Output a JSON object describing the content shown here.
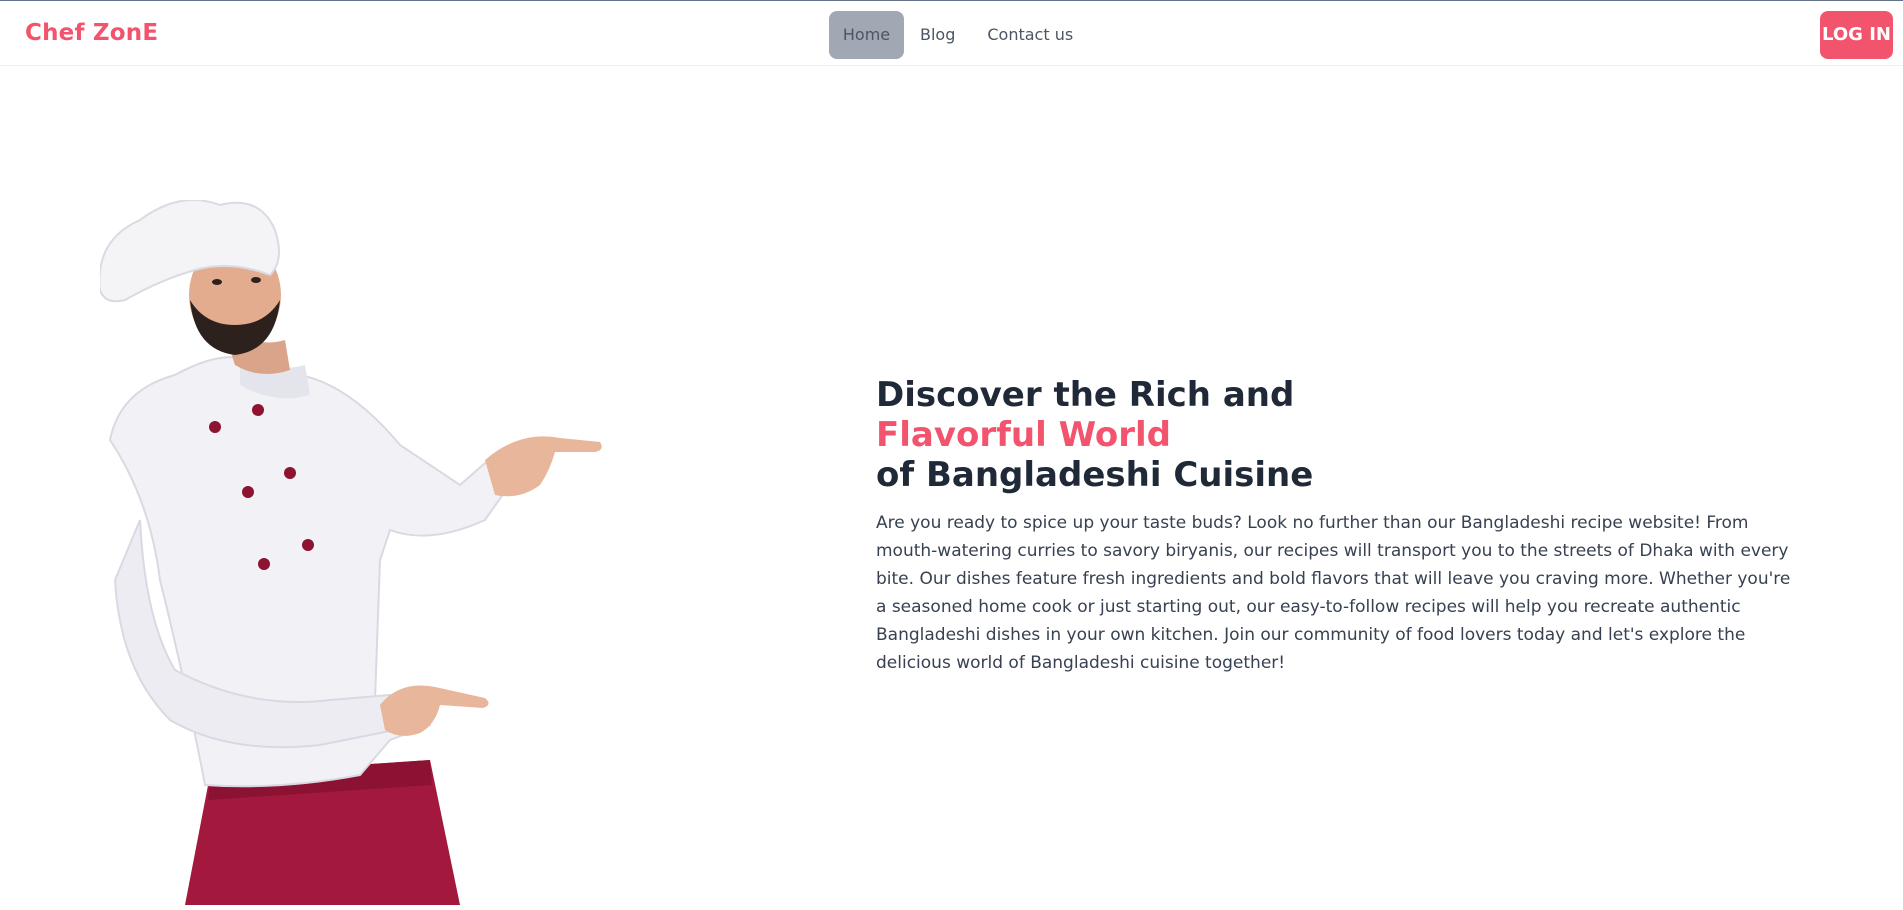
{
  "brand": {
    "name": "Chef ZonE"
  },
  "nav": {
    "items": [
      {
        "label": "Home",
        "active": true
      },
      {
        "label": "Blog",
        "active": false
      },
      {
        "label": "Contact us",
        "active": false
      }
    ],
    "login_label": "LOG IN"
  },
  "hero": {
    "title_line1": "Discover the Rich and",
    "title_accent": "Flavorful World",
    "title_line3": "of Bangladeshi Cuisine",
    "description": "Are you ready to spice up your taste buds? Look no further than our Bangladeshi recipe website! From mouth-watering curries to savory biryanis, our recipes will transport you to the streets of Dhaka with every bite. Our dishes feature fresh ingredients and bold flavors that will leave you craving more. Whether you're a seasoned home cook or just starting out, our easy-to-follow recipes will help you recreate authentic Bangladeshi dishes in your own kitchen. Join our community of food lovers today and let's explore the delicious world of Bangladeshi cuisine together!"
  },
  "colors": {
    "accent": "#f2546d",
    "heading": "#1f2937",
    "body_text": "#374151",
    "nav_active_bg": "#a1a7b3",
    "apron": "#a3183d"
  }
}
